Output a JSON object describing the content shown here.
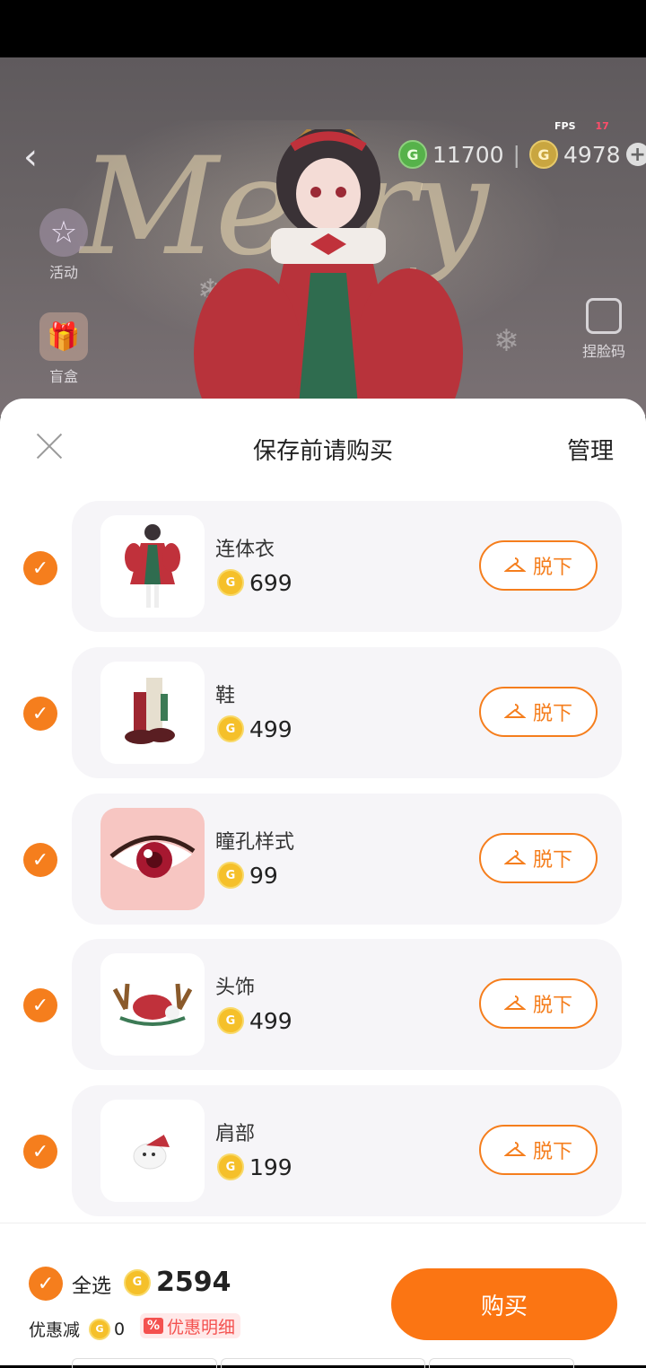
{
  "status": {
    "fps_label": "FPS",
    "fps_value": "17"
  },
  "header": {
    "back_icon": "chevron-left-icon",
    "green_currency": "11700",
    "gold_currency": "4978",
    "green_coin_glyph": "G",
    "gold_coin_glyph": "G",
    "add_icon": "plus-icon"
  },
  "side_left": [
    {
      "label": "活动",
      "icon": "star-icon"
    },
    {
      "label": "盲盒",
      "icon": "gift-box-icon"
    }
  ],
  "side_right": [
    {
      "label": "捏脸码",
      "icon": "face-code-icon"
    }
  ],
  "background_text": "Merry",
  "sheet": {
    "title": "保存前请购买",
    "manage_label": "管理",
    "items": [
      {
        "name": "连体衣",
        "price": "699",
        "button": "脱下",
        "thumb": "dress-thumbnail"
      },
      {
        "name": "鞋",
        "price": "499",
        "button": "脱下",
        "thumb": "shoes-thumbnail"
      },
      {
        "name": "瞳孔样式",
        "price": "99",
        "button": "脱下",
        "thumb": "eye-thumbnail"
      },
      {
        "name": "头饰",
        "price": "499",
        "button": "脱下",
        "thumb": "antler-headwear-thumbnail"
      },
      {
        "name": "肩部",
        "price": "199",
        "button": "脱下",
        "thumb": "shoulder-pet-thumbnail"
      }
    ]
  },
  "footer": {
    "select_all_label": "全选",
    "total": "2594",
    "discount_label": "优惠减",
    "discount_value": "0",
    "discount_badge": "%",
    "discount_detail": "优惠明细",
    "buy_label": "购买"
  },
  "colors": {
    "accent": "#f57e1d",
    "buy_button": "#fb7513",
    "coin": "#f5c02a",
    "discount": "#f4514f"
  }
}
